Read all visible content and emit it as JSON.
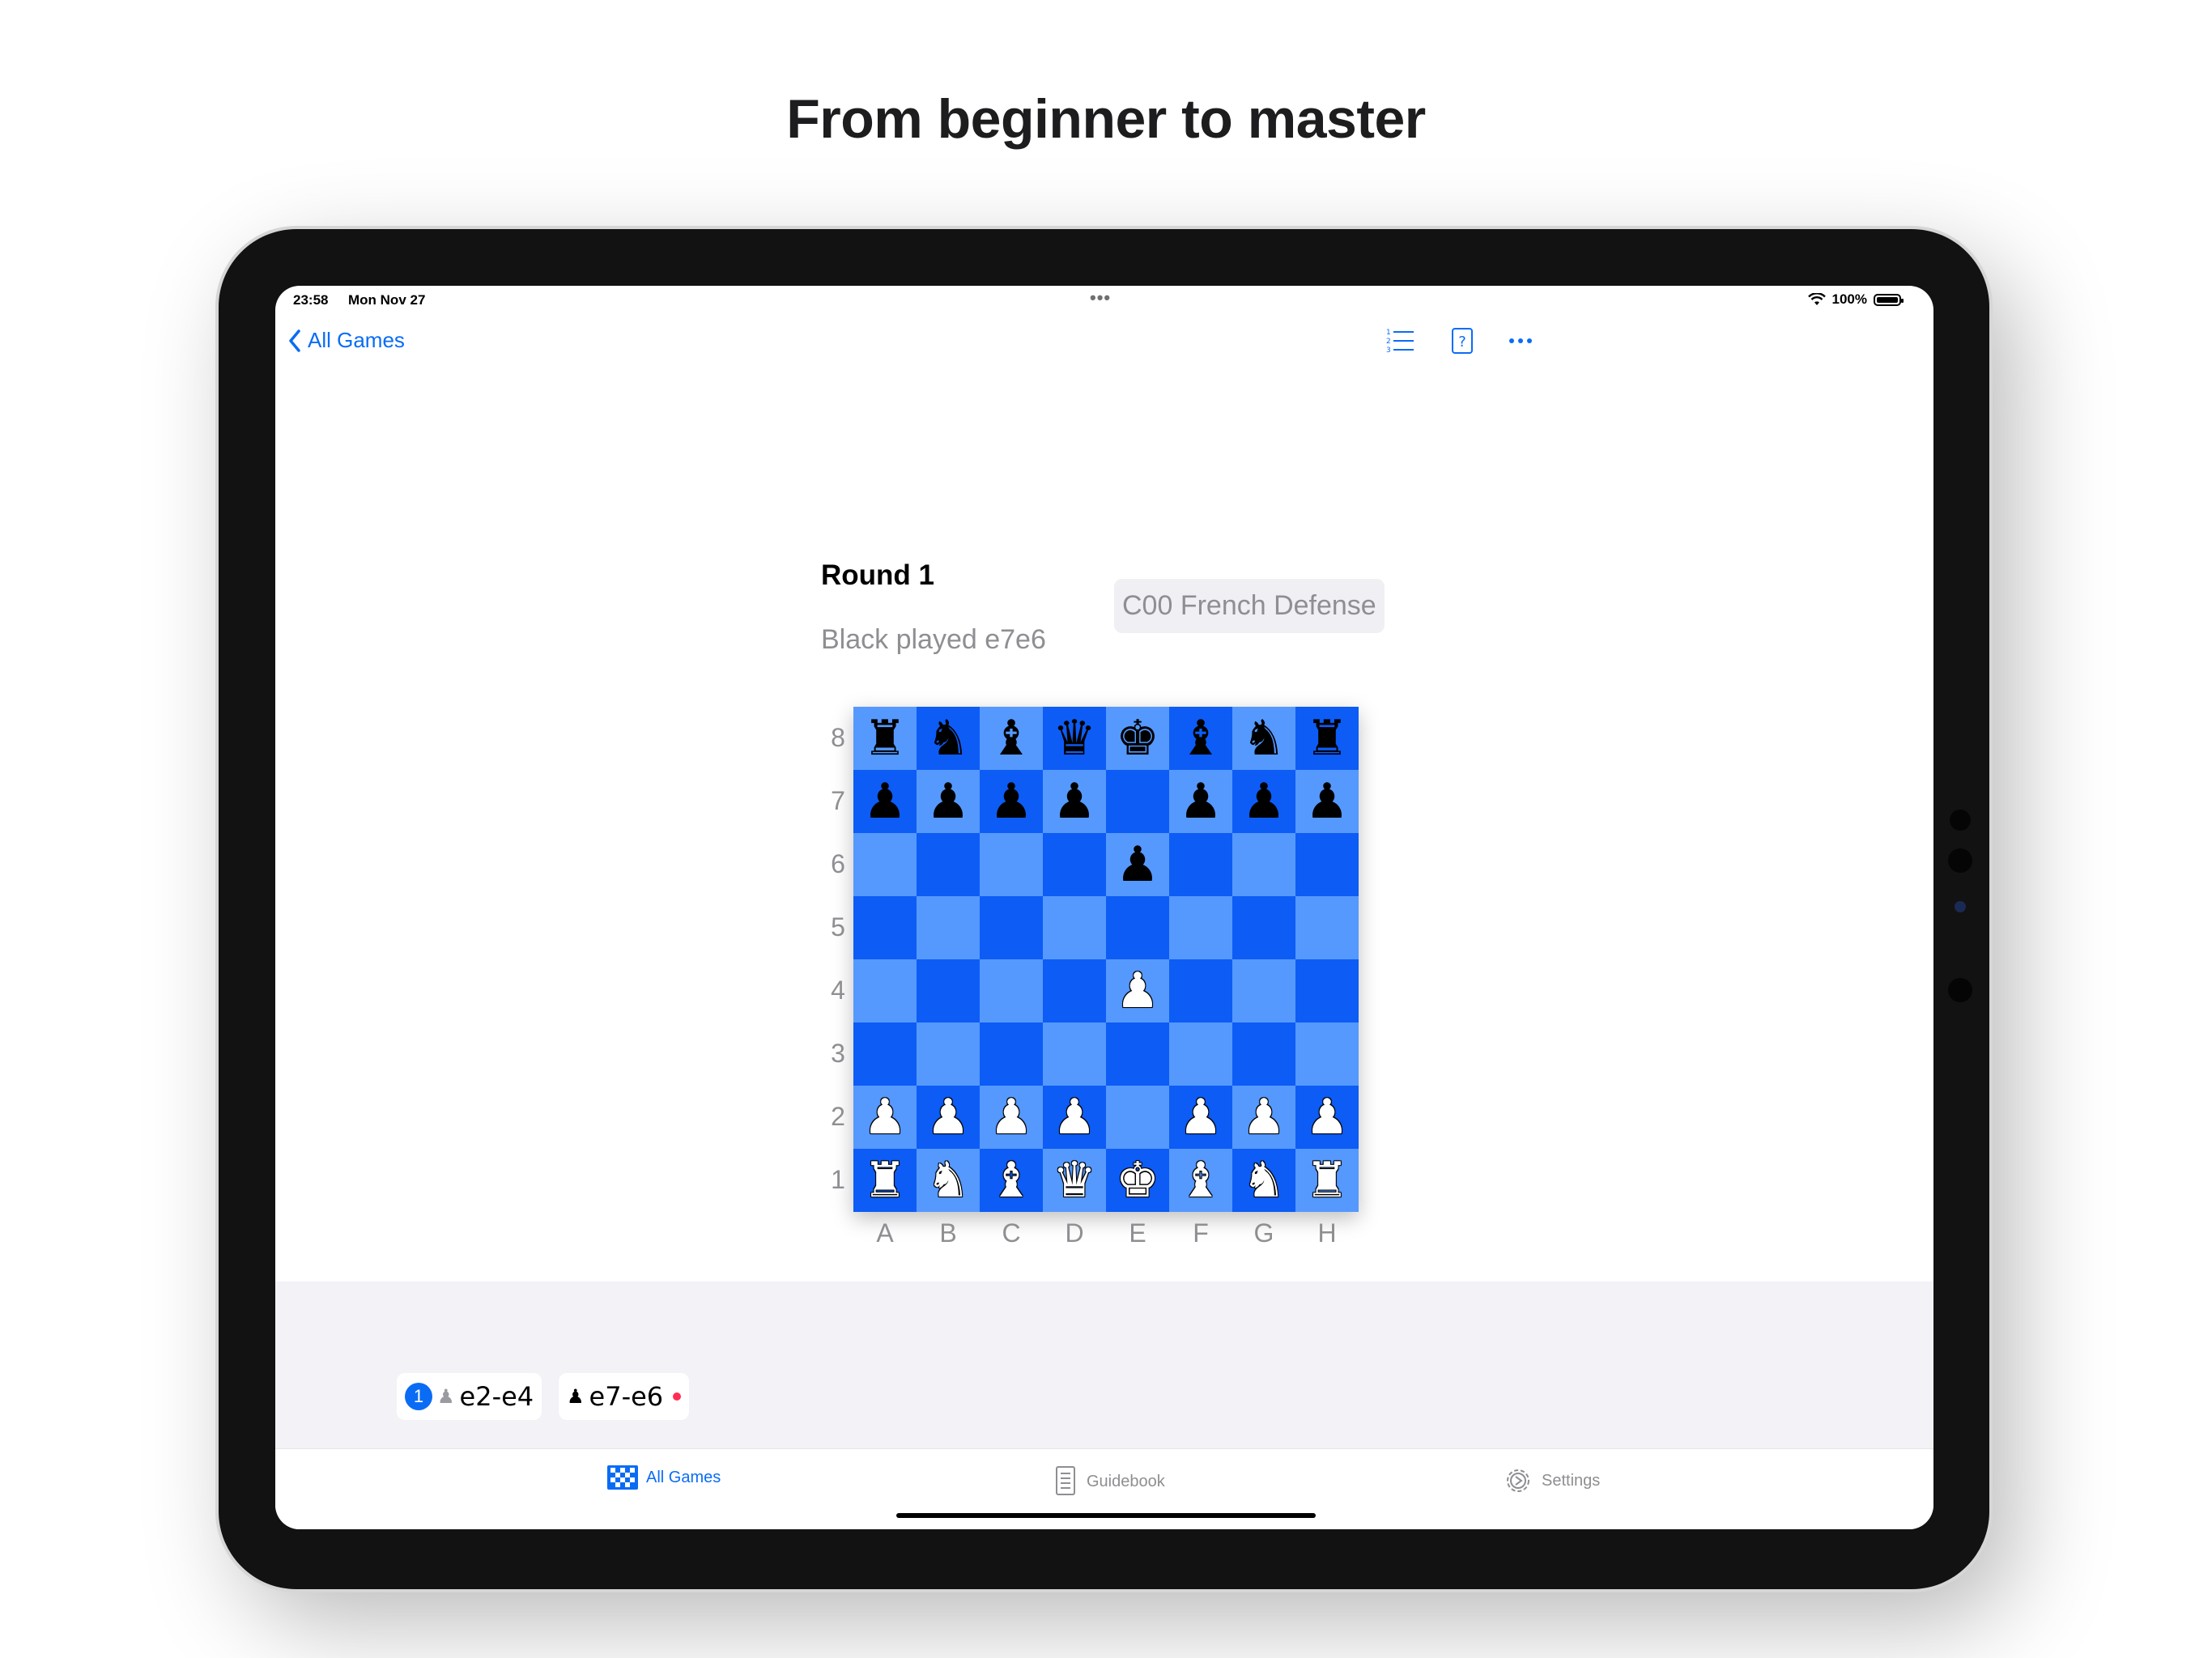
{
  "headline": "From beginner to master",
  "status_bar": {
    "time": "23:58",
    "date": "Mon Nov 27",
    "battery": "100%",
    "battery_level": 1.0
  },
  "nav": {
    "back_label": "All Games",
    "icons": [
      "list-icon",
      "help-icon",
      "more-icon"
    ]
  },
  "game": {
    "round_title": "Round 1",
    "last_move": "Black played e7e6",
    "opening": "C00 French Defense"
  },
  "board": {
    "ranks": [
      "8",
      "7",
      "6",
      "5",
      "4",
      "3",
      "2",
      "1"
    ],
    "files": [
      "A",
      "B",
      "C",
      "D",
      "E",
      "F",
      "G",
      "H"
    ],
    "rows": [
      [
        "br",
        "bn",
        "bb",
        "bq",
        "bk",
        "bb",
        "bn",
        "br"
      ],
      [
        "bp",
        "bp",
        "bp",
        "bp",
        "",
        "bp",
        "bp",
        "bp"
      ],
      [
        "",
        "",
        "",
        "",
        "bp",
        "",
        "",
        ""
      ],
      [
        "",
        "",
        "",
        "",
        "",
        "",
        "",
        ""
      ],
      [
        "",
        "",
        "",
        "",
        "wp",
        "",
        "",
        ""
      ],
      [
        "",
        "",
        "",
        "",
        "",
        "",
        "",
        ""
      ],
      [
        "wp",
        "wp",
        "wp",
        "wp",
        "",
        "wp",
        "wp",
        "wp"
      ],
      [
        "wr",
        "wn",
        "wb",
        "wq",
        "wk",
        "wb",
        "wn",
        "wr"
      ]
    ],
    "colors": {
      "light": "#5599ff",
      "dark": "#0d5cf5"
    }
  },
  "moves": {
    "number": "1",
    "white": "e2-e4",
    "black": "e7-e6"
  },
  "tabs": [
    {
      "label": "All Games",
      "icon": "board-icon",
      "active": true
    },
    {
      "label": "Guidebook",
      "icon": "book-icon",
      "active": false
    },
    {
      "label": "Settings",
      "icon": "gear-icon",
      "active": false
    }
  ],
  "accent": "#0a6cf5"
}
